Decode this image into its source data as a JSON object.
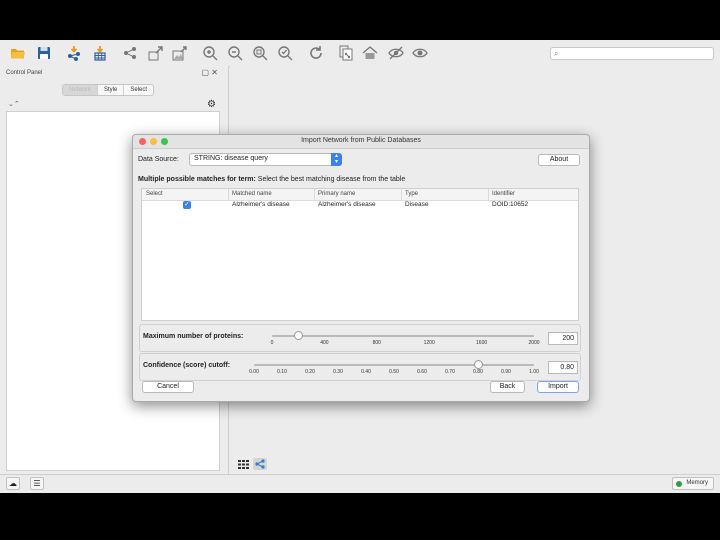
{
  "window": {
    "control_panel_title": "Control Panel",
    "control_panel_tabs": [
      "Network",
      "Style",
      "Select"
    ],
    "search_placeholder": ""
  },
  "toolbar_icons": [
    "open-folder-icon",
    "save-icon",
    "import-network-icon",
    "import-table-icon",
    "share-network-icon",
    "export-network-icon",
    "export-image-icon",
    "zoom-in-icon",
    "zoom-out-icon",
    "zoom-fit-icon",
    "zoom-selected-icon",
    "refresh-icon",
    "new-network-icon",
    "home-icon",
    "hide-icon",
    "show-icon"
  ],
  "dialog": {
    "title": "Import Network from Public Databases",
    "data_source_label": "Data Source:",
    "data_source_value": "STRING: disease query",
    "about_label": "About",
    "heading_bold": "Multiple possible matches for term:",
    "heading_rest": " Select the best matching disease from the table",
    "table": {
      "columns": [
        "Select",
        "Matched name",
        "Primary name",
        "Type",
        "Identifier"
      ],
      "rows": [
        {
          "select": true,
          "matched_name": "Alzheimer's disease",
          "primary_name": "Alzheimer's disease",
          "type": "Disease",
          "identifier": "DOID:10652"
        }
      ]
    },
    "max_proteins": {
      "label": "Maximum number of proteins:",
      "ticks": [
        "0",
        "400",
        "800",
        "1200",
        "1600",
        "2000"
      ],
      "value": "200",
      "range": [
        0,
        2000
      ]
    },
    "confidence": {
      "label": "Confidence (score) cutoff:",
      "ticks": [
        "0.00",
        "0.10",
        "0.20",
        "0.30",
        "0.40",
        "0.50",
        "0.60",
        "0.70",
        "0.80",
        "0.90",
        "1.00"
      ],
      "value": "0.80",
      "range": [
        0,
        1
      ]
    },
    "cancel_label": "Cancel",
    "back_label": "Back",
    "import_label": "Import"
  },
  "status": {
    "memory_label": "Memory",
    "memory_color": "#2a9d4b"
  },
  "colors": {
    "accent": "#3b82f0",
    "close": "#fc605c",
    "minimize": "#fdbc40",
    "maximize": "#34c84a"
  }
}
